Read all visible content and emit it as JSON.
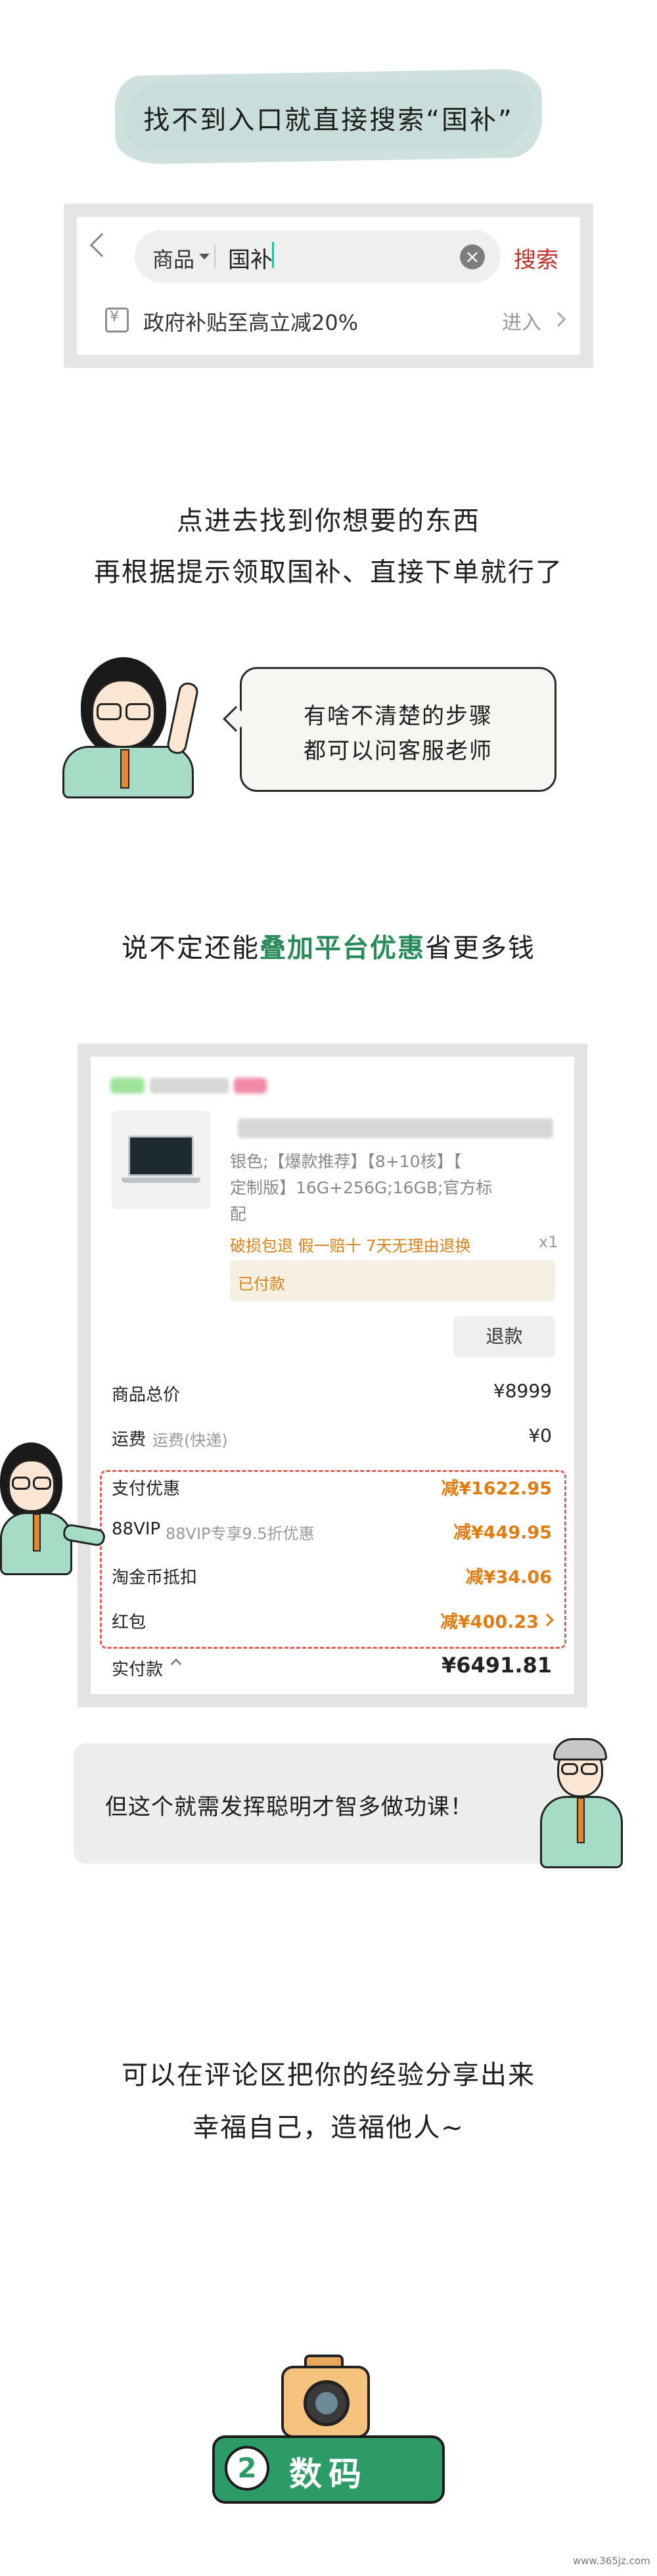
{
  "section1": {
    "title": "找不到入口就直接搜索“国补”"
  },
  "search_screen": {
    "category": "商品",
    "query": "国补",
    "clear_icon": "clear-x-icon",
    "search_button": "搜索",
    "subsidy_icon_char": "¥",
    "subsidy_text": "政府补贴至高立减20%",
    "enter_text": "进入"
  },
  "instructions": {
    "line1": "点进去找到你想要的东西",
    "line2": "再根据提示领取国补、直接下单就行了"
  },
  "speech": {
    "line1": "有啥不清楚的步骤",
    "line2": "都可以问客服老师"
  },
  "stack_line": {
    "before": "说不定还能",
    "highlight": "叠加平台优惠",
    "after": "省更多钱"
  },
  "order": {
    "spec_line1": "银色;【爆款推荐】【8+10核】【",
    "spec_line2": "定制版】16G+256G;16GB;官方标",
    "spec_line3": "配",
    "service_tags": "破损包退  假一赔十  7天无理由退换",
    "quantity": "x1",
    "paid_status": "已付款",
    "refund_button": "退款",
    "rows": {
      "total_label": "商品总价",
      "total_value": "¥8999",
      "shipping_label": "运费",
      "shipping_sub": "运费(快递)",
      "shipping_value": "¥0",
      "pay_discount_label": "支付优惠",
      "pay_discount_value": "减¥1622.95",
      "vip_label": "88VIP",
      "vip_sub": "88VIP专享9.5折优惠",
      "vip_value": "减¥449.95",
      "coin_label": "淘金币抵扣",
      "coin_value": "减¥34.06",
      "redpacket_label": "红包",
      "redpacket_value": "减¥400.23",
      "actual_label": "实付款",
      "actual_value": "¥6491.81"
    }
  },
  "tip": {
    "text": "但这个就需发挥聪明才智多做功课！"
  },
  "share": {
    "line1": "可以在评论区把你的经验分享出来",
    "line2": "幸福自己，造福他人~"
  },
  "footer": {
    "section_number": "2",
    "section_title": "数码",
    "camera_icon": "camera-icon",
    "watermark": "www.365jz.com"
  },
  "colors": {
    "accent_green": "#2c9b67",
    "highlight_green": "#2a8a5c",
    "discount_orange": "#e07c14",
    "search_red": "#c0312b",
    "dashed_red": "#e0605a"
  }
}
